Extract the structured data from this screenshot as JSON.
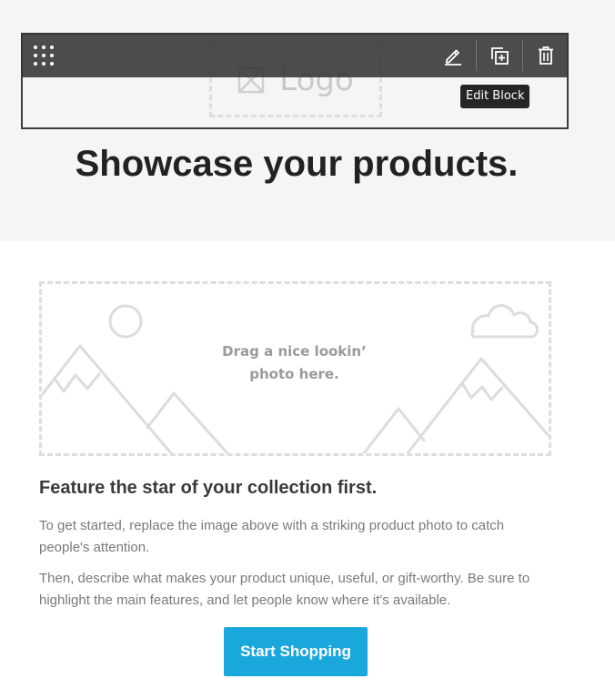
{
  "header": {
    "logo_text": "Logo",
    "headline": "Showcase your products."
  },
  "toolbar": {
    "drag_icon": "drag-handle-icon",
    "edit_icon": "pencil-icon",
    "duplicate_icon": "duplicate-icon",
    "delete_icon": "trash-icon",
    "tooltip": "Edit Block"
  },
  "image_block": {
    "hint_line1": "Drag a nice lookin’",
    "hint_line2": "photo here."
  },
  "content": {
    "title": "Feature the star of your collection first.",
    "paragraph1": "To get started, replace the image above with a striking product photo to catch people's attention.",
    "paragraph2": "Then, describe what makes your product unique, useful, or gift-worthy. Be sure to highlight the main features, and let people know where it's available.",
    "button_label": "Start Shopping"
  },
  "colors": {
    "header_background": "#f5f5f5",
    "headline": "#222222",
    "button": "#1aa7dc",
    "toolbar": "#343434",
    "placeholder_line": "#dedede"
  }
}
